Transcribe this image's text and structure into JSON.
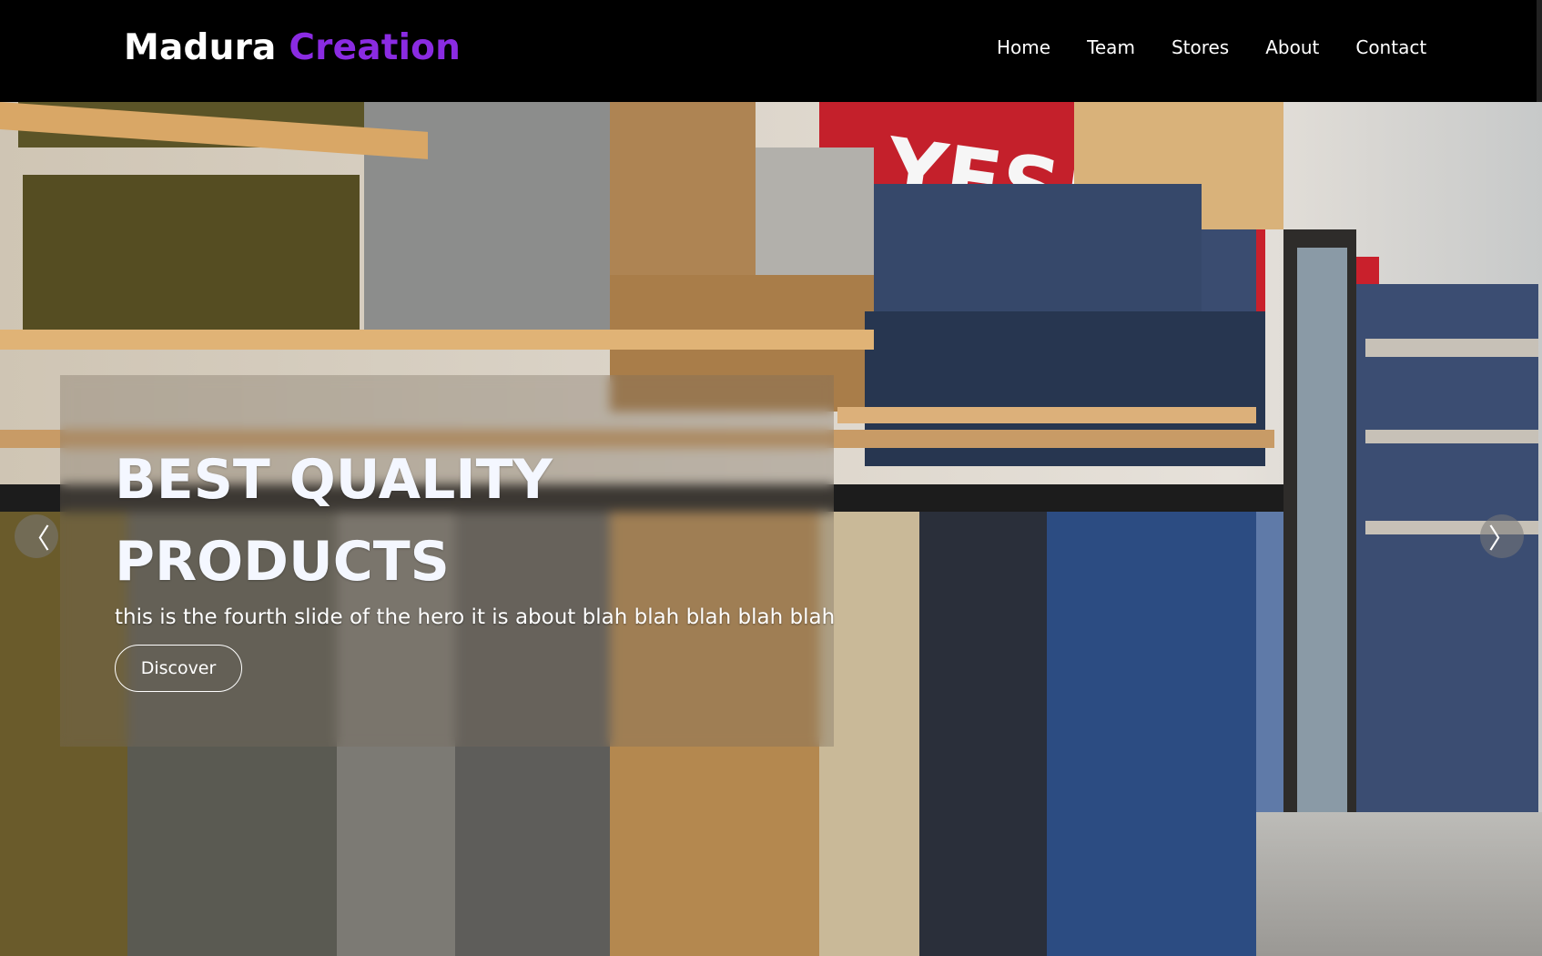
{
  "brand": {
    "part1": "Madura",
    "part2": "Creation",
    "accent_color": "#8a2be2"
  },
  "nav": [
    {
      "label": "Home"
    },
    {
      "label": "Team"
    },
    {
      "label": "Stores"
    },
    {
      "label": "About"
    },
    {
      "label": "Contact"
    }
  ],
  "hero": {
    "headline": "BEST QUALITY PRODUCTS",
    "subtext": "this is the fourth slide of the hero it is about blah blah blah blah blah",
    "button_label": "Discover",
    "prev_icon": "chevron-left-icon",
    "next_icon": "chevron-right-icon",
    "prev_glyph": "〈",
    "next_glyph": "〉"
  }
}
